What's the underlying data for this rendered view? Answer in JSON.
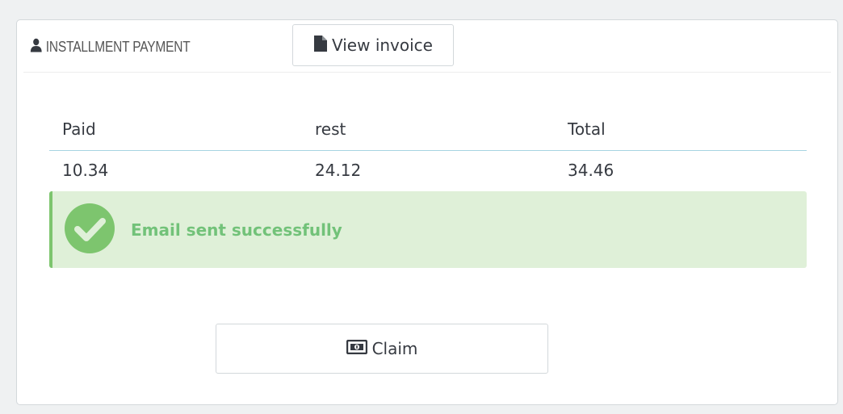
{
  "panel": {
    "title": "INSTALLMENT PAYMENT",
    "title_icon": "user-icon",
    "view_invoice": {
      "label": "View invoice",
      "icon": "file-icon"
    }
  },
  "table": {
    "columns": [
      "Paid",
      "rest",
      "Total"
    ],
    "rows": [
      [
        "10.34",
        "24.12",
        "34.46"
      ]
    ]
  },
  "alert": {
    "message": "Email sent successfully",
    "icon": "check-circle-icon",
    "color": "#72c279",
    "background": "#dff0d8"
  },
  "claim": {
    "label": "Claim",
    "icon": "money-icon"
  }
}
